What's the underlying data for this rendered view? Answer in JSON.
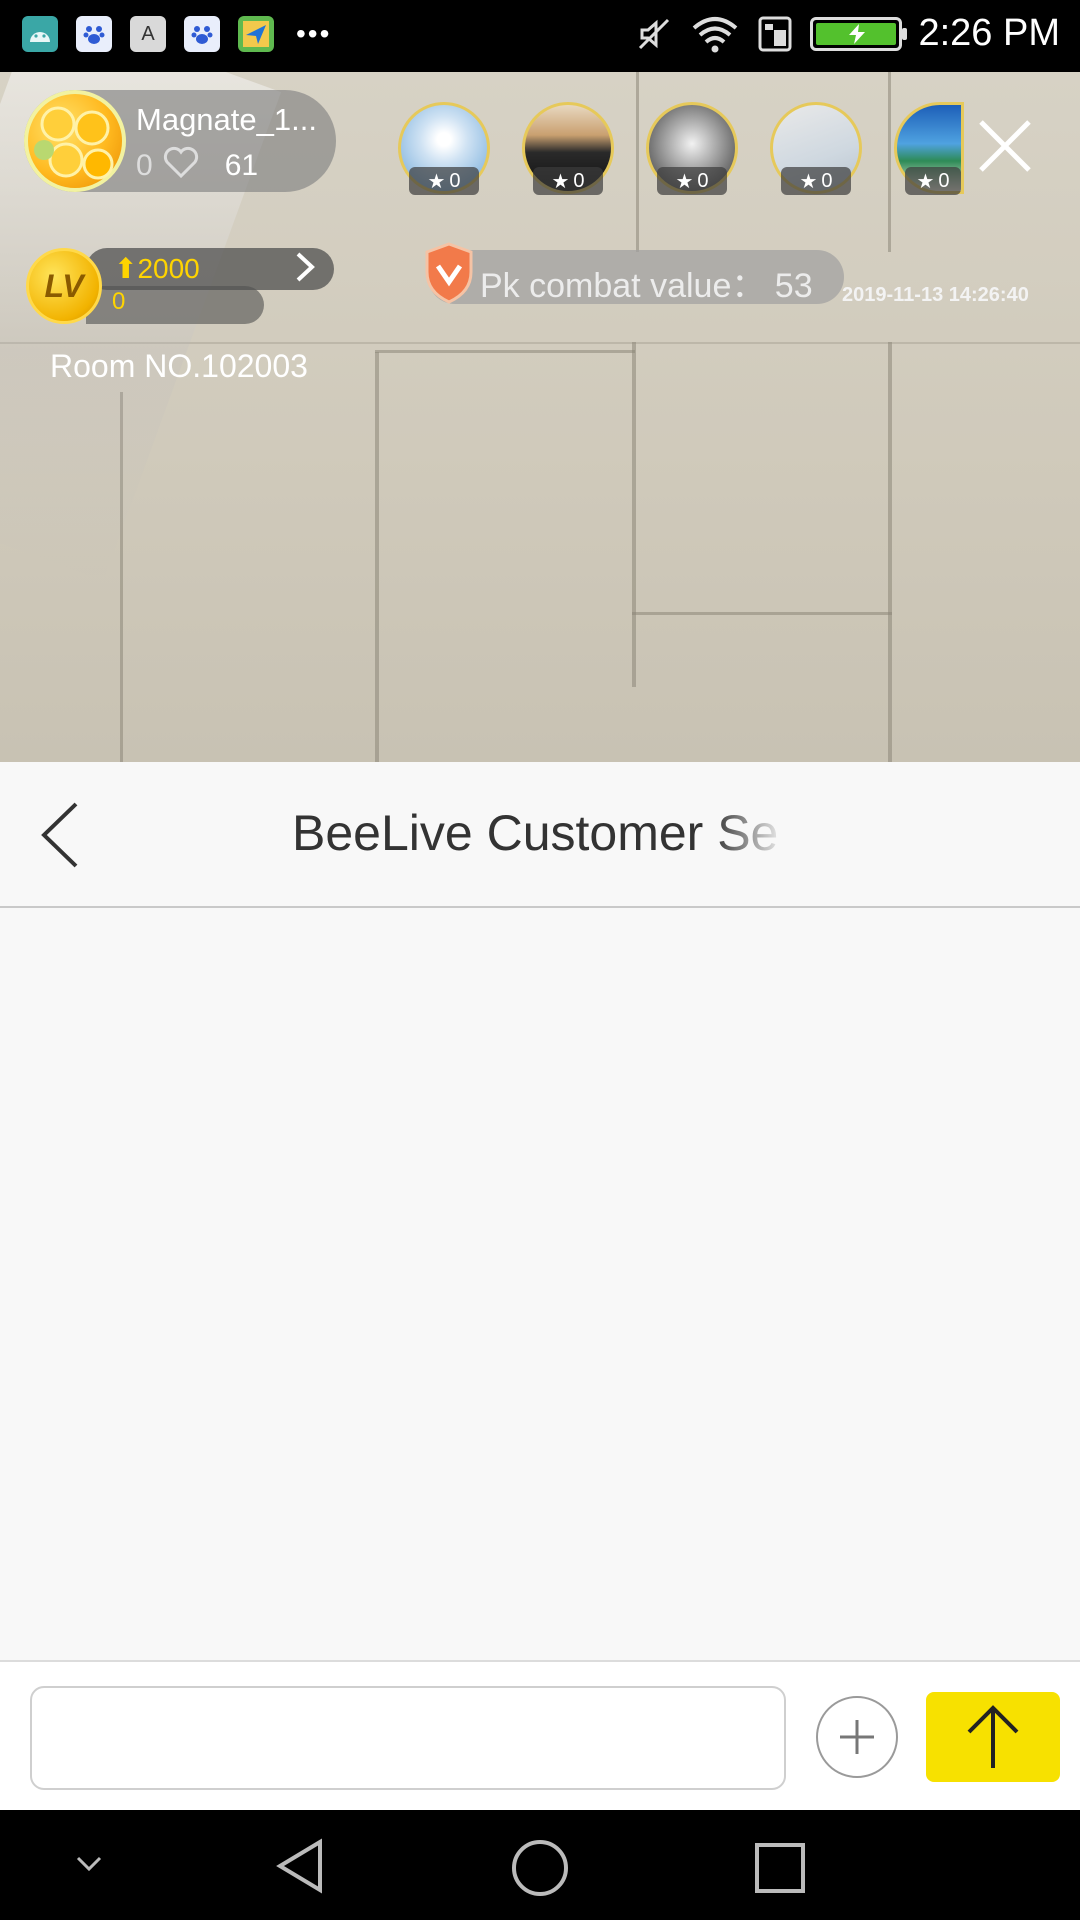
{
  "status_bar": {
    "time": "2:26 PM",
    "left_icons": [
      "android-icon",
      "baidu-icon",
      "font-a-icon",
      "baidu-icon",
      "maps-icon"
    ],
    "more_glyph": "•••",
    "colors": {
      "battery_fill": "#53c12d"
    }
  },
  "live": {
    "host": {
      "name": "Magnate_1...",
      "likes_zero": "0",
      "count": "61"
    },
    "viewers": [
      {
        "badge": "0",
        "icon": "dandelion-photo"
      },
      {
        "badge": "0",
        "icon": "city-skyline-photo"
      },
      {
        "badge": "0",
        "icon": "portrait-photo"
      },
      {
        "badge": "0",
        "icon": "beach-shells-photo"
      },
      {
        "badge": "0",
        "icon": "beach-photo"
      }
    ],
    "level": {
      "label": "LV",
      "up_value": "2000",
      "sub_value": "0"
    },
    "pk": {
      "text": "Pk combat value： 53"
    },
    "timestamp": "2019-11-13 14:26:40",
    "room": "Room NO.102003"
  },
  "chat": {
    "title": "BeeLive Customer Se",
    "input": {
      "value": "",
      "placeholder": ""
    },
    "colors": {
      "send_button": "#f7e100"
    }
  },
  "nav": [
    "down-chevron-icon",
    "back-triangle-icon",
    "home-circle-icon",
    "recents-square-icon"
  ]
}
